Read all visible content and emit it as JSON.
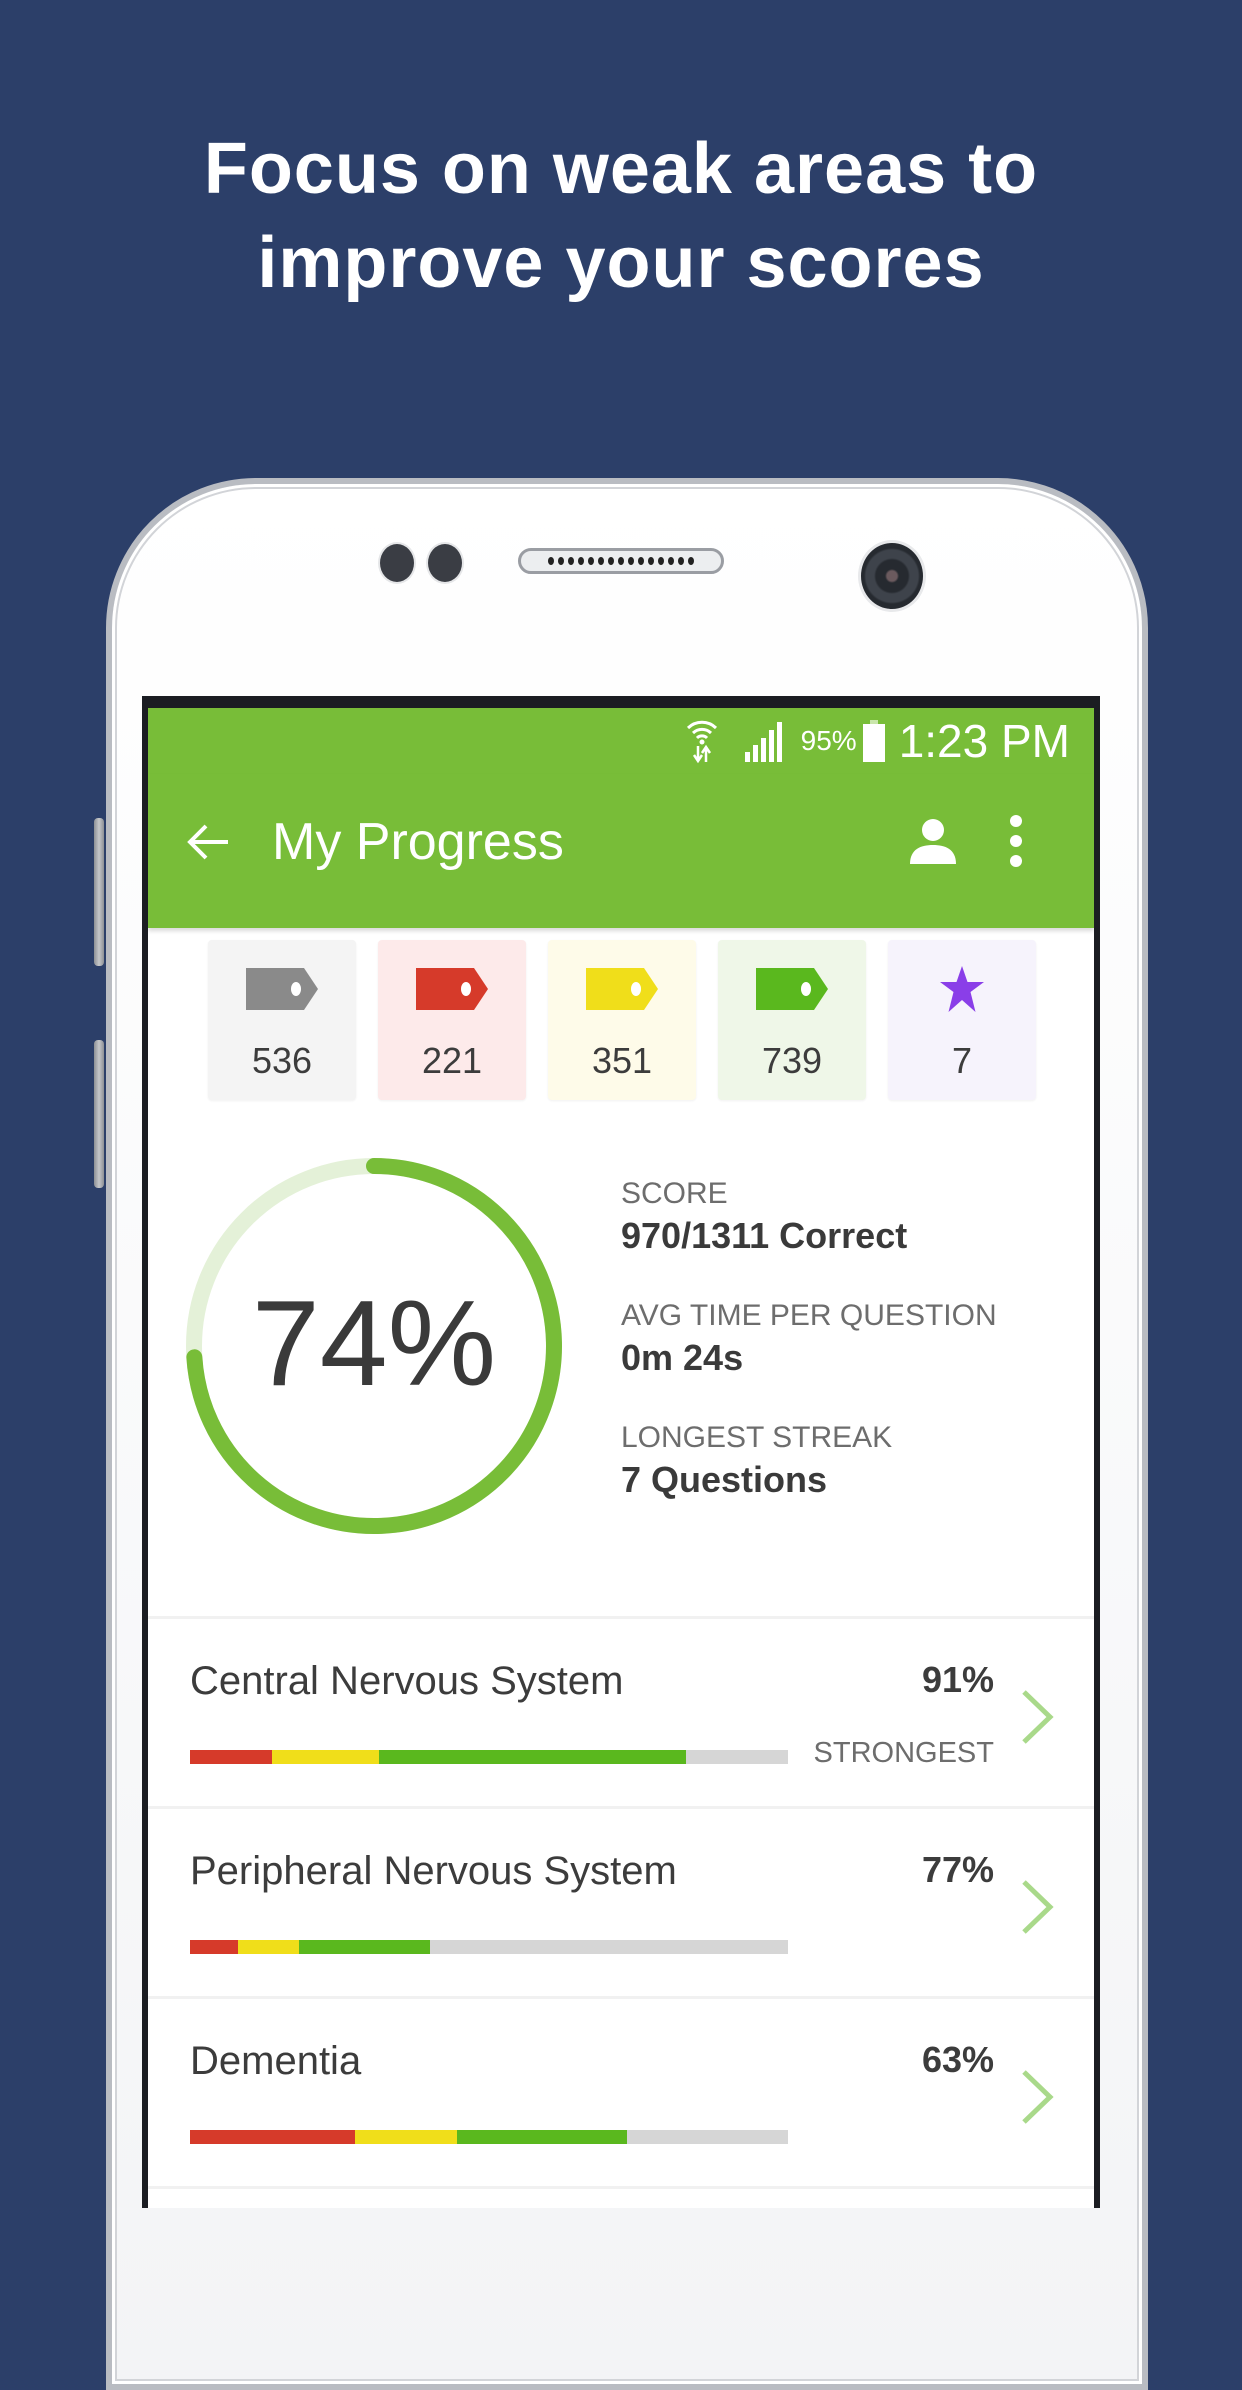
{
  "headline": {
    "line1": "Focus on weak areas to",
    "line2": "improve your scores"
  },
  "status_bar": {
    "battery_percent": "95%",
    "time": "1:23 PM",
    "icons": [
      "wifi-data-icon",
      "signal-icon",
      "battery-icon"
    ]
  },
  "app_bar": {
    "title": "My Progress",
    "back_icon": "arrow-left-icon",
    "profile_icon": "person-icon",
    "menu_icon": "more-vert-icon",
    "color": "#78bd38"
  },
  "tag_filters": [
    {
      "name": "unanswered",
      "icon": "tag-icon",
      "color": "#8a8a8a",
      "bg": "#f4f4f4",
      "count": "536"
    },
    {
      "name": "incorrect",
      "icon": "tag-icon",
      "color": "#d63a2a",
      "bg": "#fdeaea",
      "count": "221"
    },
    {
      "name": "partial",
      "icon": "tag-icon",
      "color": "#f0de1a",
      "bg": "#fefbe9",
      "count": "351"
    },
    {
      "name": "correct",
      "icon": "tag-icon",
      "color": "#5ab81e",
      "bg": "#eff7e8",
      "count": "739"
    },
    {
      "name": "starred",
      "icon": "star-icon",
      "color": "#8a3ee8",
      "bg": "#f6f3fc",
      "count": "7"
    }
  ],
  "score_ring": {
    "label": "74%",
    "fraction": 0.74,
    "color": "#78bd38",
    "track_color": "#e4f1d8"
  },
  "stats": [
    {
      "key": "SCORE",
      "value": "970/1311 Correct"
    },
    {
      "key": "AVG TIME PER QUESTION",
      "value": "0m  24s"
    },
    {
      "key": "LONGEST STREAK",
      "value": "7 Questions"
    }
  ],
  "topics": [
    {
      "name": "Central Nervous System",
      "percent": "91%",
      "badge": "STRONGEST",
      "segments": {
        "incorrect": 0.137,
        "partial": 0.179,
        "correct": 0.513
      }
    },
    {
      "name": "Peripheral Nervous System",
      "percent": "77%",
      "badge": "",
      "segments": {
        "incorrect": 0.08,
        "partial": 0.102,
        "correct": 0.219
      }
    },
    {
      "name": "Dementia",
      "percent": "63%",
      "badge": "",
      "segments": {
        "incorrect": 0.276,
        "partial": 0.171,
        "correct": 0.283
      }
    }
  ],
  "segment_colors": {
    "incorrect": "#d63a2a",
    "partial": "#f0de1a",
    "correct": "#5ab81e",
    "remaining": "#d6d6d6"
  }
}
